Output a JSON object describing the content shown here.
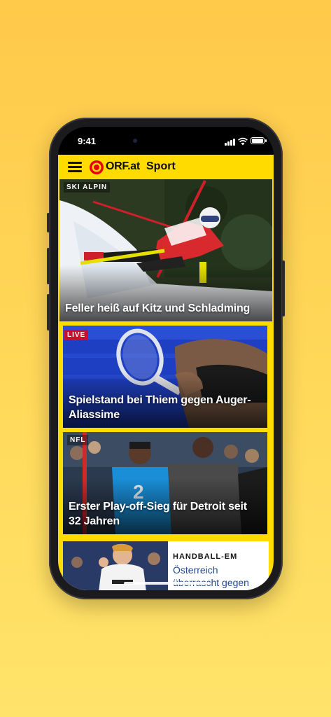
{
  "status_bar": {
    "time": "9:41"
  },
  "app_bar": {
    "brand": "ORF.at",
    "section": "Sport"
  },
  "articles": [
    {
      "category": "SKI ALPIN",
      "title": "Feller heiß auf Kitz und Schladming"
    },
    {
      "category": "LIVE",
      "title": "Spielstand bei Thiem gegen Auger-Aliassime"
    },
    {
      "category": "NFL",
      "title": "Erster Play-off-Sieg für Detroit seit 32 Jahren"
    },
    {
      "category": "HANDBALL-EM",
      "title": "Österreich überrascht gegen Kroatien"
    }
  ],
  "colors": {
    "background": "#FFD24E",
    "brand_yellow": "#FFDB00",
    "orf_red": "#E3000F",
    "live_red": "#C8102E",
    "link_blue": "#1F4A8C"
  },
  "icons": [
    "menu-icon",
    "orf-logo-icon",
    "signal-icon",
    "wifi-icon",
    "battery-icon"
  ]
}
